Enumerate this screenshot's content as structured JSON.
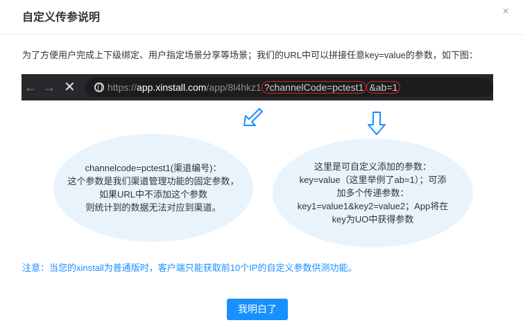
{
  "dialog": {
    "title": "自定义传参说明",
    "close_icon": "×"
  },
  "intro_text": "为了方便用户完成上下级绑定、用户指定场景分享等场景；我们的URL中可以拼接任意key=value的参数，如下图：",
  "browser": {
    "back_icon": "←",
    "forward_icon": "→",
    "close_icon": "✕",
    "url_scheme": "https://",
    "url_host": "app.xinstall.com",
    "url_path": "/app/8l4hkz1",
    "param_fixed": "?channelCode=pctest1",
    "param_custom": "&ab=1"
  },
  "bubbles": {
    "left": "channelcode=pctest1(渠道编号)：\n这个参数是我们渠道管理功能的固定参数，\n如果URL中不添加这个参数\n则统计到的数据无法对应到渠道。",
    "right": "这里是可自定义添加的参数：\nkey=value（这里举例了ab=1）；可添\n加多个传递参数：\nkey1=value1&key2=value2；App将在\nkey为UO中获得参数"
  },
  "note": "注意：当您的xinstall为普通版时，客户端只能获取前10个IP的自定义参数供测功能。",
  "confirm_button": "我明白了",
  "colors": {
    "accent": "#1890ff",
    "highlight_border": "#e02424",
    "bubble_bg": "#e9f3fb",
    "browser_bg": "#27282b"
  }
}
